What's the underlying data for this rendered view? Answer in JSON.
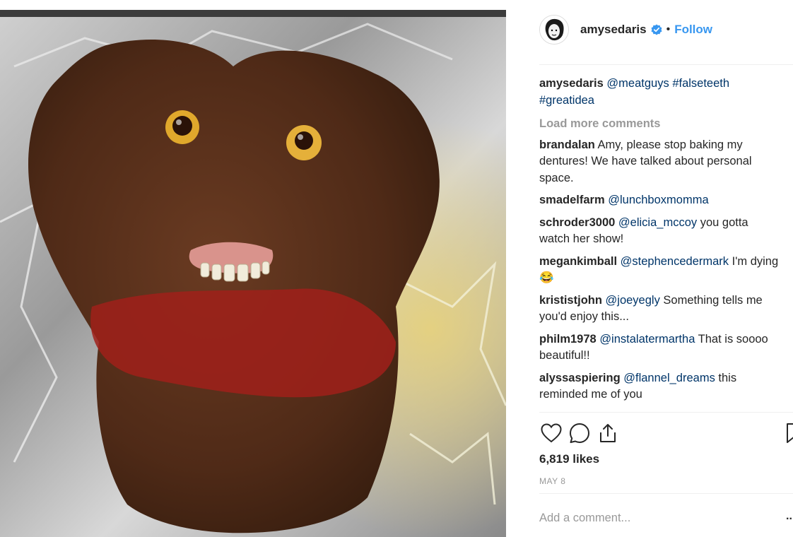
{
  "post": {
    "username": "amysedaris",
    "follow_label": "Follow",
    "separator": "•",
    "caption": {
      "user": "amysedaris",
      "parts": [
        "@meatguys",
        " ",
        "#falseteeth",
        " ",
        "#greatidea"
      ]
    },
    "load_more": "Load more comments",
    "comments": [
      {
        "user": "brandalan",
        "mention": "",
        "text": "Amy, please stop baking my dentures! We have talked about personal space."
      },
      {
        "user": "smadelfarm",
        "mention": "@lunchboxmomma",
        "text": ""
      },
      {
        "user": "schroder3000",
        "mention": "@elicia_mccoy",
        "text": "you gotta watch her show!"
      },
      {
        "user": "megankimball",
        "mention": "@stephencedermark",
        "text": "I'm dying 😂"
      },
      {
        "user": "krististjohn",
        "mention": "@joeyegly",
        "text": "Something tells me you'd enjoy this..."
      },
      {
        "user": "philm1978",
        "mention": "@instalatermartha",
        "text": "That is soooo beautiful!!"
      },
      {
        "user": "alyssaspiering",
        "mention": "@flannel_dreams",
        "text": "this reminded me of you"
      }
    ],
    "likes": "6,819 likes",
    "date": "MAY 8",
    "add_comment_placeholder": "Add a comment...",
    "more_label": "..."
  },
  "colors": {
    "accent": "#3897f0",
    "mention": "#003569",
    "muted": "#999999"
  },
  "icons": [
    "verified-badge-icon",
    "heart-icon",
    "comment-icon",
    "share-icon",
    "bookmark-icon"
  ]
}
